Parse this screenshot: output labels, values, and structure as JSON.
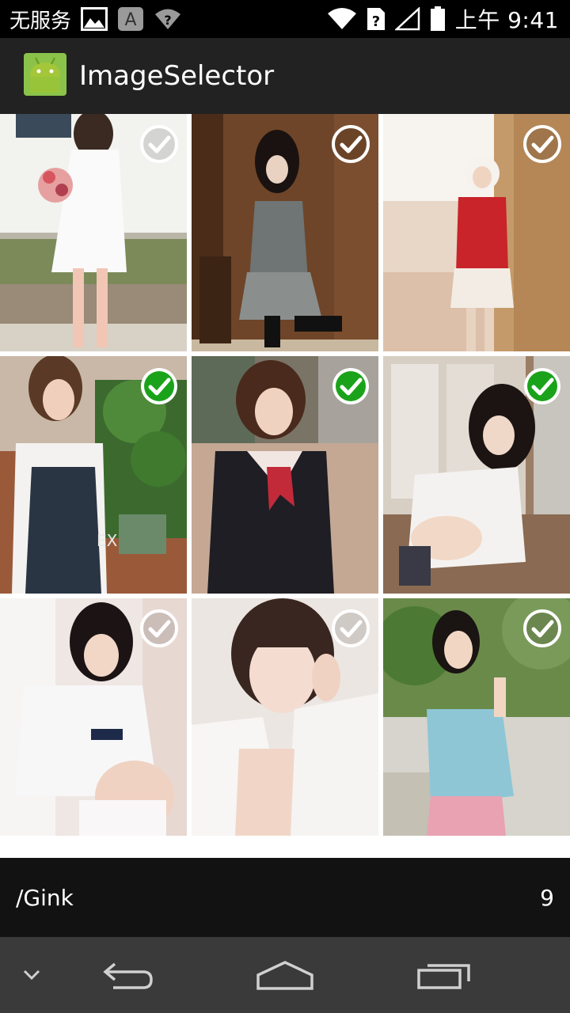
{
  "status_bar": {
    "carrier": "无服务",
    "time": "上午 9:41",
    "icons": [
      "image-icon",
      "a-notification-icon",
      "wifi-unknown-icon",
      "wifi-icon",
      "sim-unknown-icon",
      "signal-empty-icon",
      "battery-icon"
    ]
  },
  "action_bar": {
    "icon": "android-icon",
    "title": "ImageSelector"
  },
  "grid": {
    "images": [
      {
        "subject": "girl-white-dress-flowers",
        "selected": false
      },
      {
        "subject": "girl-dark-room-chair",
        "selected": false
      },
      {
        "subject": "girl-red-sweater-wall",
        "selected": false
      },
      {
        "subject": "girl-overalls-plant",
        "selected": true
      },
      {
        "subject": "girl-sailor-uniform",
        "selected": true
      },
      {
        "subject": "girl-sitting-window",
        "selected": true
      },
      {
        "subject": "girl-white-shirt-curtain",
        "selected": false
      },
      {
        "subject": "girl-white-fur",
        "selected": false
      },
      {
        "subject": "girl-blue-top-street",
        "selected": false
      }
    ]
  },
  "bottom_bar": {
    "folder": "/Gink",
    "count": "9"
  },
  "nav_bar": {
    "icons": [
      "chevron-down-icon",
      "back-icon",
      "home-icon",
      "recents-icon"
    ]
  },
  "colors": {
    "selected_check": "#1aa31a",
    "unselected_check": "#ffffff",
    "action_bar": "#222222",
    "bottom_bar": "#121212",
    "nav_bar": "#3a3a3a"
  }
}
